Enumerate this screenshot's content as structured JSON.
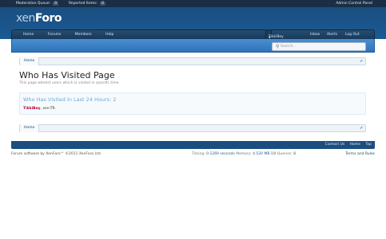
{
  "moderator_bar": {
    "moderation_queue_label": "Moderation Queue:",
    "moderation_queue_count": "0",
    "reported_items_label": "Reported Items:",
    "reported_items_count": "0",
    "admin_control_panel": "Admin Control Panel"
  },
  "logo": {
    "xen": "xen",
    "foro": "Foro"
  },
  "nav": {
    "home": "Home",
    "forums": "Forums",
    "members": "Members",
    "help": "Help",
    "username": "TikkiBey",
    "inbox": "Inbox",
    "alerts": "Alerts",
    "logout": "Log Out"
  },
  "search": {
    "placeholder": "Search..."
  },
  "breadcrumb": {
    "home": "Home"
  },
  "page": {
    "title": "Who Has Visited Page",
    "description": "This page wiktest users which is visited in specific time"
  },
  "visitors": {
    "heading": "Who Has Visited In Last 24 Hours: 2",
    "user1": "TikkiBey",
    "separator": ", ",
    "user2": "xen-TR",
    "trailing": "."
  },
  "footer": {
    "contact_us": "Contact Us",
    "home": "Home",
    "top": "Top",
    "copyright": "Forum software by XenForo™ ©2011 XenForo Ltd.",
    "timing_label": "Timing:",
    "timing_value": "0.1269 seconds",
    "memory_label": "Memory:",
    "memory_value": "4.520 MB",
    "queries_label": "DB Queries:",
    "queries_value": "8",
    "terms": "Terms and Rules"
  },
  "colors": {
    "header": "#1a5a94",
    "subnav": "#2e74ba",
    "accent_heading": "#6aa8d8",
    "staff_username": "#b1003a"
  }
}
